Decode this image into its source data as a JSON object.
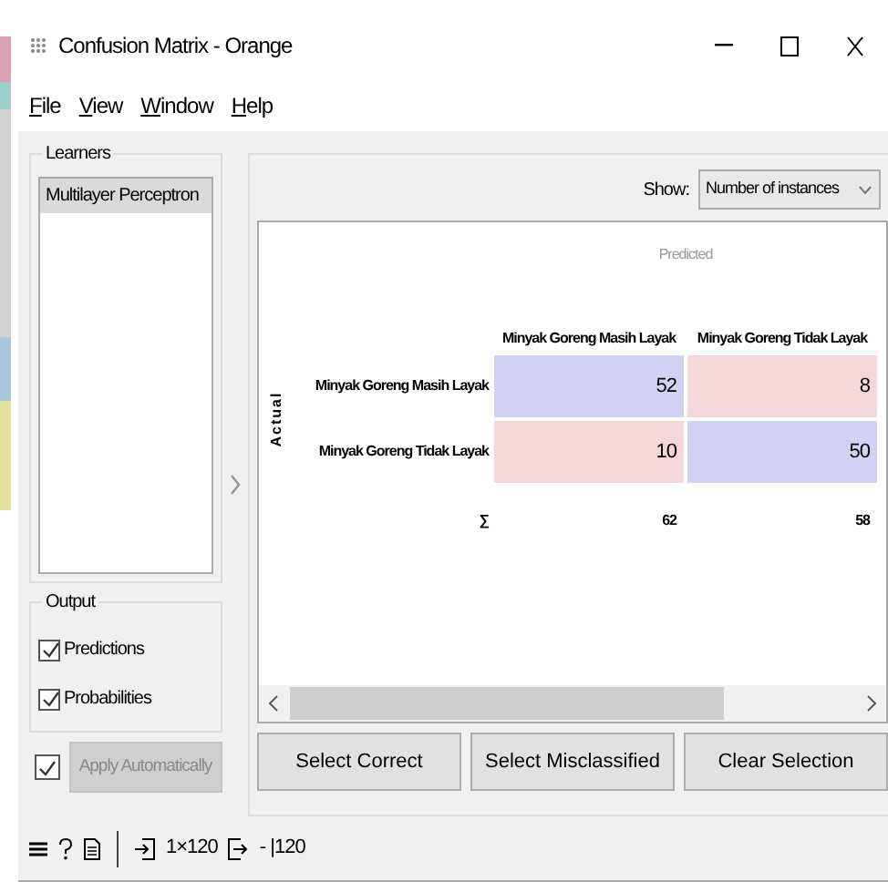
{
  "window": {
    "title": "Confusion Matrix - Orange"
  },
  "menu": [
    "File",
    "View",
    "Window",
    "Help"
  ],
  "learners": {
    "title": "Learners",
    "items": [
      {
        "label": "Multilayer Perceptron",
        "selected": true
      }
    ]
  },
  "output": {
    "title": "Output",
    "options": [
      {
        "label": "Predictions",
        "checked": true
      },
      {
        "label": "Probabilities",
        "checked": true
      }
    ]
  },
  "apply": {
    "checked": true,
    "label": "Apply Automatically",
    "disabled": true
  },
  "show": {
    "label": "Show:",
    "value": "Number of instances"
  },
  "matrix": {
    "predicted_label": "Predicted",
    "actual_label": "Actual",
    "columns": [
      "Minyak Goreng Masih Layak",
      "Minyak Goreng Tidak Layak"
    ],
    "rows": [
      {
        "label": "Minyak Goreng Masih Layak",
        "cells": [
          {
            "value": "52",
            "color": "#d2d2f4"
          },
          {
            "value": "8",
            "color": "#f4d6d8"
          }
        ]
      },
      {
        "label": "Minyak Goreng Tidak Layak",
        "cells": [
          {
            "value": "10",
            "color": "#f4d6d8"
          },
          {
            "value": "50",
            "color": "#d2d2f4"
          }
        ]
      }
    ],
    "sum_symbol": "∑",
    "sums": [
      "62",
      "58"
    ]
  },
  "buttons": [
    "Select Correct",
    "Select Misclassified",
    "Clear Selection"
  ],
  "status_bar": {
    "input_count": "1×120",
    "output_count": "- |120"
  }
}
